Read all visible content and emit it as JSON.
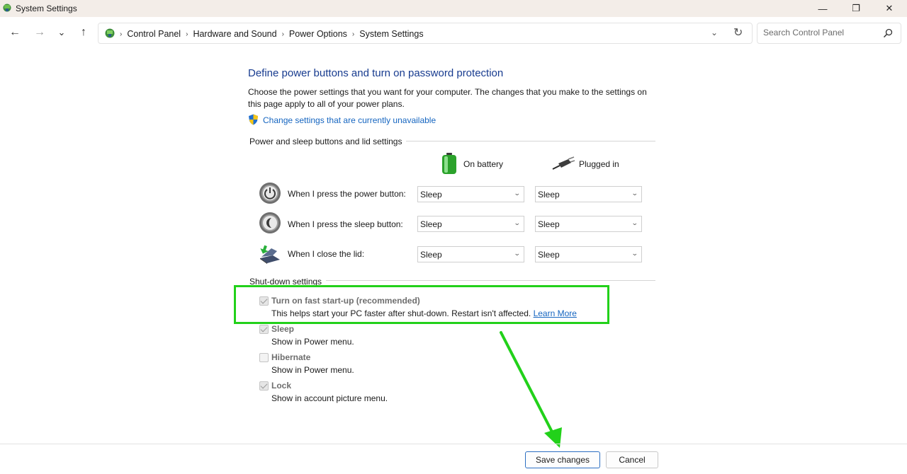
{
  "window": {
    "title": "System Settings",
    "minimize": "—",
    "maximize": "❐",
    "close": "✕"
  },
  "nav": {
    "back": "←",
    "forward": "→",
    "recent": "⌄",
    "up": "↑"
  },
  "address": {
    "crumbs": [
      "Control Panel",
      "Hardware and Sound",
      "Power Options",
      "System Settings"
    ],
    "separator": "›",
    "dropdown": "⌄",
    "refresh": "↻"
  },
  "search": {
    "placeholder": "Search Control Panel"
  },
  "page": {
    "heading": "Define power buttons and turn on password protection",
    "description": "Choose the power settings that you want for your computer. The changes that you make to the settings on this page apply to all of your power plans.",
    "change_link": "Change settings that are currently unavailable"
  },
  "power_section": {
    "label": "Power and sleep buttons and lid settings",
    "col_battery": "On battery",
    "col_plugged": "Plugged in",
    "rows": [
      {
        "label": "When I press the power button:",
        "battery": "Sleep",
        "plugged": "Sleep"
      },
      {
        "label": "When I press the sleep button:",
        "battery": "Sleep",
        "plugged": "Sleep"
      },
      {
        "label": "When I close the lid:",
        "battery": "Sleep",
        "plugged": "Sleep"
      }
    ],
    "chevron": "⌄"
  },
  "shutdown_section": {
    "label": "Shut-down settings",
    "options": [
      {
        "title": "Turn on fast start-up (recommended)",
        "desc": "This helps start your PC faster after shut-down. Restart isn't affected.",
        "link": "Learn More",
        "checked": true
      },
      {
        "title": "Sleep",
        "desc": "Show in Power menu.",
        "checked": true
      },
      {
        "title": "Hibernate",
        "desc": "Show in Power menu.",
        "checked": false
      },
      {
        "title": "Lock",
        "desc": "Show in account picture menu.",
        "checked": true
      }
    ]
  },
  "footer": {
    "save": "Save changes",
    "cancel": "Cancel"
  },
  "colors": {
    "highlight": "#22d11a",
    "link": "#1565c0",
    "heading": "#173b8f"
  }
}
